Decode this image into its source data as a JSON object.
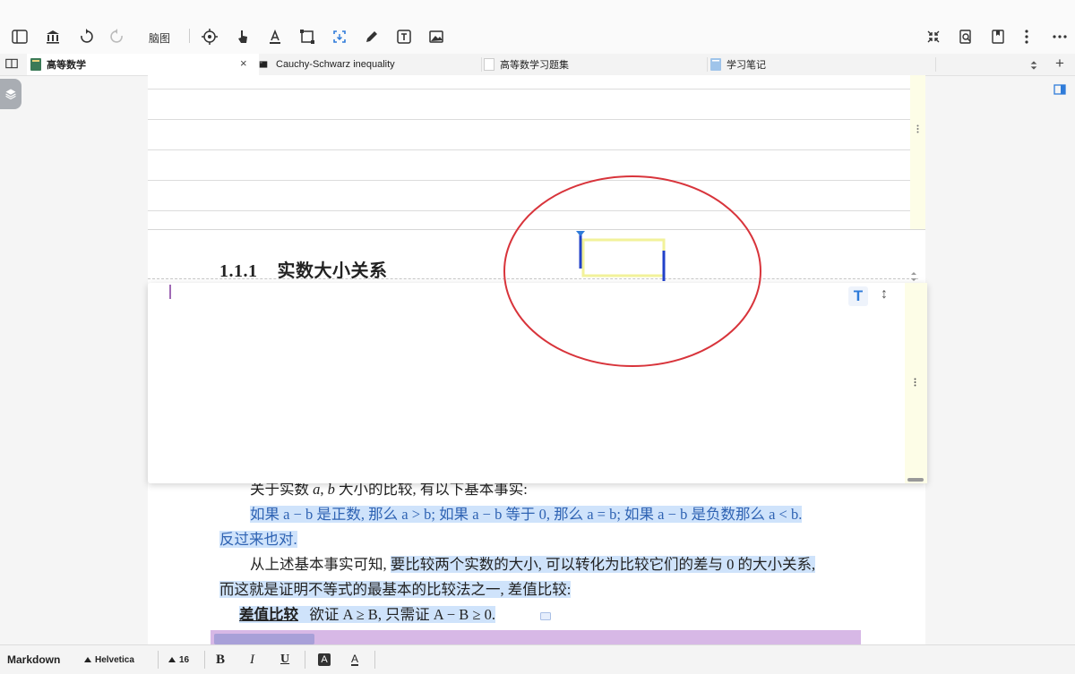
{
  "toolbar": {
    "mindmap_label": "脑图"
  },
  "tabs": [
    {
      "label": "高等数学"
    },
    {
      "label": "Cauchy-Schwarz inequality"
    },
    {
      "label": "高等数学习题集"
    },
    {
      "label": "学习笔记"
    }
  ],
  "tab_actions": {
    "close": "×",
    "add": "+"
  },
  "page": {
    "section_number": "1.1.1",
    "section_title": "实数大小关系",
    "p1_prefix": "关于实数 ",
    "var_a": "a",
    "comma": ", ",
    "var_b": "b",
    "p1_suffix": " 大小的比较, 有以下基本事实:",
    "blue_line1": "如果 a − b 是正数, 那么 a > b; 如果 a − b 等于 0, 那么 a = b; 如果 a − b 是负数那么 a < b.",
    "blue_line2": "反过来也对.",
    "p2_prefix": "从上述基本事实可知, ",
    "p2_highlight": "要比较两个实数的大小, 可以转化为比较它们的差与 0 的大小关系,",
    "p2_line2": "而这就是证明不等式的最基本的比较法之一, 差值比较:",
    "term_label": "差值比较",
    "term_body": "欲证 A ≥ B, 只需证 A − B ≥ 0."
  },
  "card": {
    "text_icon_label": "T",
    "resize_icon_label": "↕"
  },
  "bottombar": {
    "mode": "Markdown",
    "font": "Helvetica",
    "size": "16",
    "bold": "B",
    "italic": "I",
    "underline": "U",
    "highlight": "A",
    "color": "A"
  },
  "colors": {
    "accent": "#2f7bd9",
    "annotation_circle": "#d8343b",
    "highlight": "#cfe3fb",
    "math_blue": "#2f63b3"
  }
}
